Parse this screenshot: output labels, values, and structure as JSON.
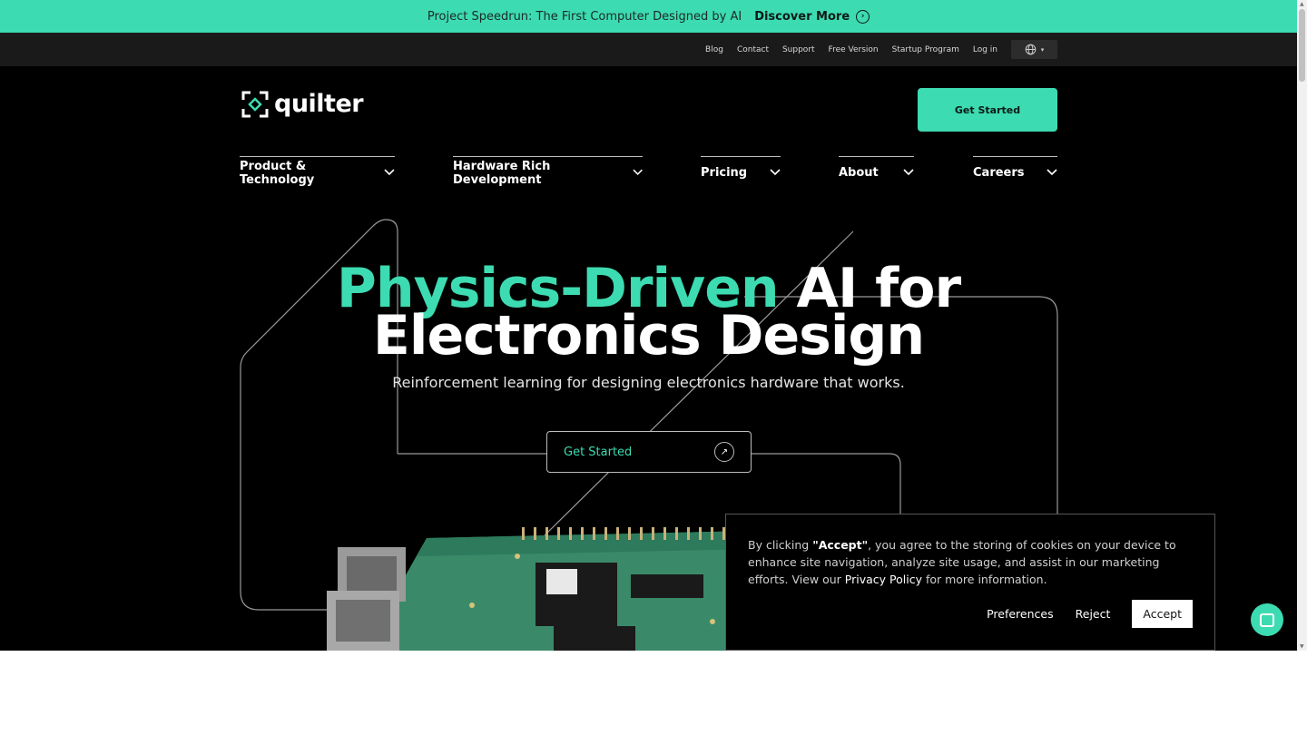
{
  "announcement": {
    "text": "Project Speedrun: The First Computer Designed by AI",
    "link_label": "Discover More"
  },
  "utility_nav": {
    "links": [
      "Blog",
      "Contact",
      "Support",
      "Free Version",
      "Startup Program",
      "Log in"
    ],
    "language_icon": "globe-icon"
  },
  "brand": {
    "name": "quilter"
  },
  "header": {
    "cta_label": "Get Started"
  },
  "main_nav": {
    "items": [
      {
        "label": "Product & Technology"
      },
      {
        "label": "Hardware Rich Development"
      },
      {
        "label": "Pricing"
      },
      {
        "label": "About"
      },
      {
        "label": "Careers"
      }
    ]
  },
  "hero": {
    "headline_green": "Physics-Driven",
    "headline_white_1": "AI for",
    "headline_line2": "Electronics Design",
    "subtitle": "Reinforcement learning for designing electronics hardware that works.",
    "cta_label": "Get Started"
  },
  "cookie_banner": {
    "prefix": "By clicking ",
    "accept_quote": "\"Accept\"",
    "body": ", you agree to the storing of cookies on your device to enhance site navigation, analyze site usage, and assist in our marketing efforts. View our ",
    "privacy_link": "Privacy Policy",
    "suffix": " for more information.",
    "preferences_label": "Preferences",
    "reject_label": "Reject",
    "accept_label": "Accept"
  },
  "colors": {
    "accent": "#3ddbb1",
    "background": "#000000",
    "utility_bar": "#1a1a1a"
  }
}
